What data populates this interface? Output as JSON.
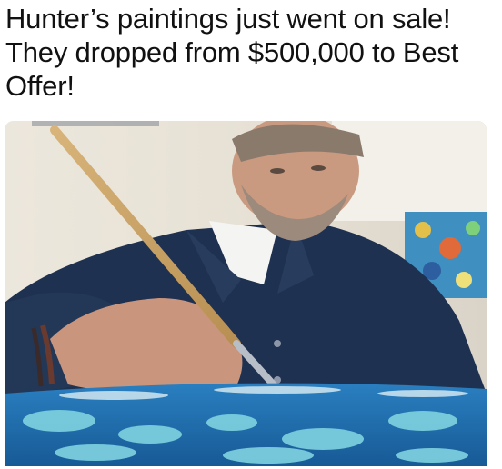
{
  "post": {
    "caption_lines": [
      "Hunter’s paintings just went on sale!",
      "They dropped from $500,000 to Best",
      "Offer!"
    ]
  },
  "photo": {
    "colors": {
      "wall": "#e9e4da",
      "jacket": "#1f3150",
      "skin": "#c99a80",
      "brush": "#c9a469",
      "canvas_blue": "#1f6fb0",
      "canvas_cyan": "#7fd3e0"
    }
  }
}
